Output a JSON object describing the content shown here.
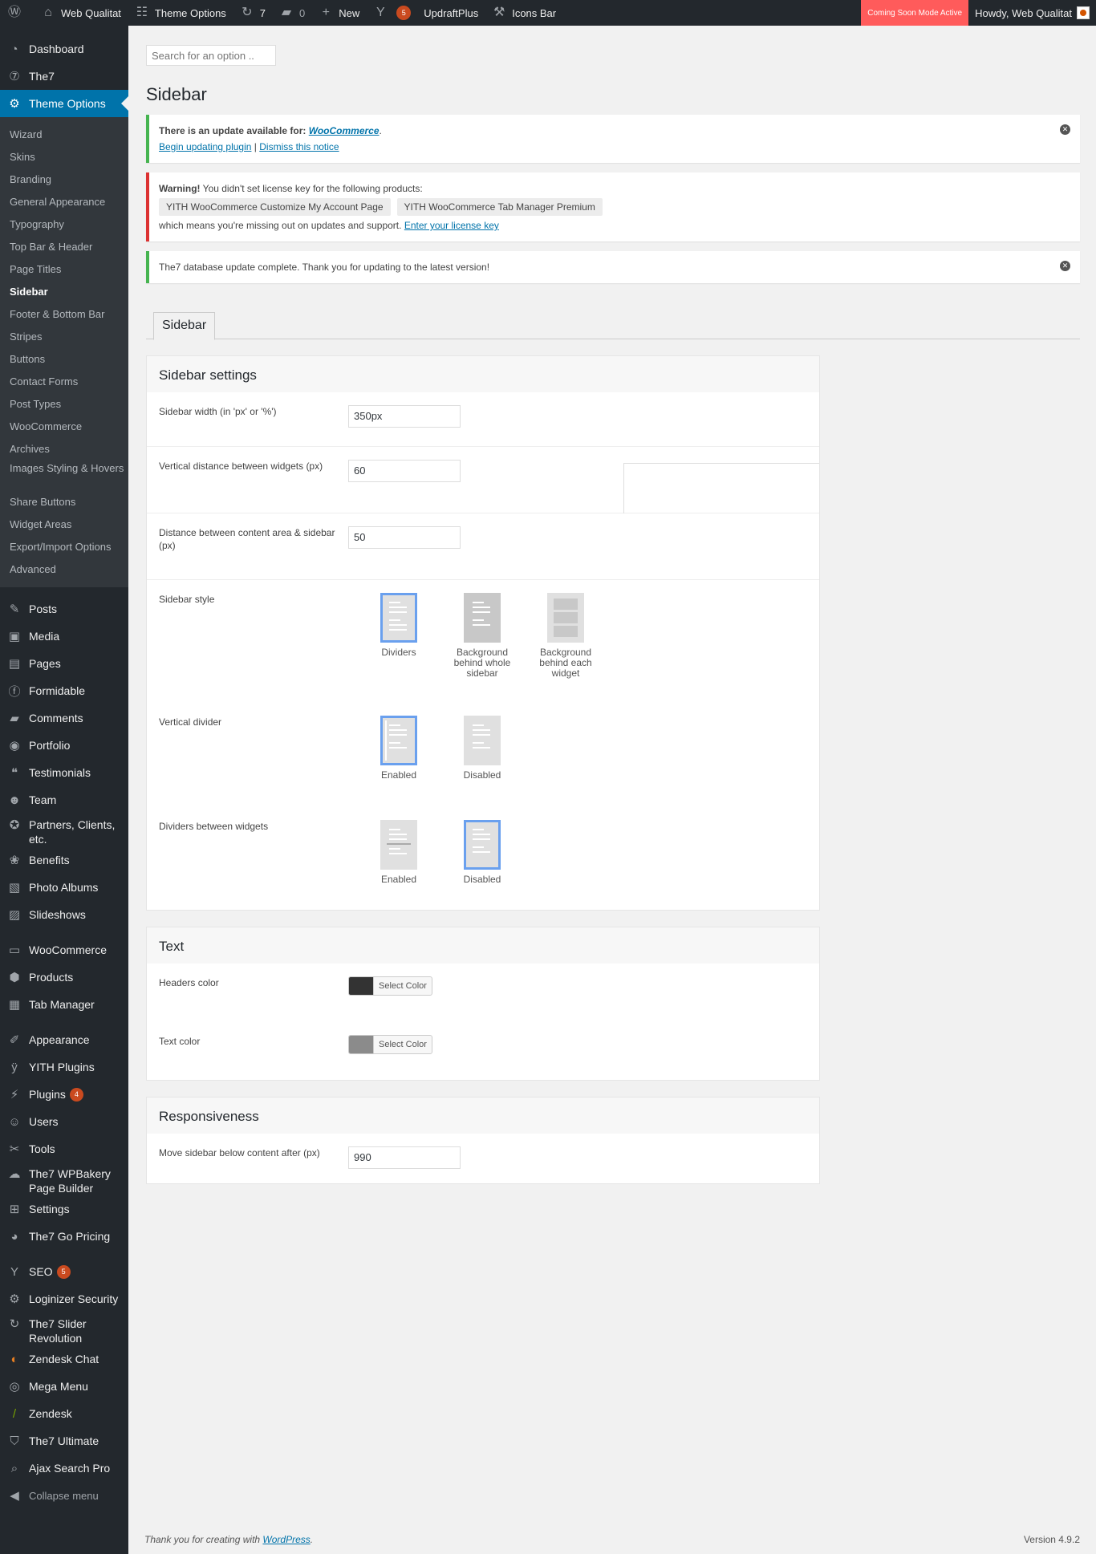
{
  "adminbar": {
    "site_name": "Web Qualitat",
    "theme_options": "Theme Options",
    "updates_count": "7",
    "comments_count": "0",
    "new_label": "New",
    "yoast_count": "5",
    "updraft": "UpdraftPlus",
    "icons_bar": "Icons Bar",
    "coming_soon": "Coming Soon Mode Active",
    "howdy": "Howdy, Web Qualitat"
  },
  "menu": {
    "top": [
      {
        "label": "Dashboard",
        "icon": "dashboard-icon"
      },
      {
        "label": "The7",
        "icon": "the7-icon"
      },
      {
        "label": "Theme Options",
        "icon": "gear-icon"
      }
    ],
    "submenu": [
      "Wizard",
      "Skins",
      "Branding",
      "General Appearance",
      "Typography",
      "Top Bar & Header",
      "Page Titles",
      "Sidebar",
      "Footer & Bottom Bar",
      "Stripes",
      "Buttons",
      "Contact Forms",
      "Post Types",
      "WooCommerce",
      "Archives",
      "Images Styling & Hovers",
      "Share Buttons",
      "Widget Areas",
      "Export/Import Options",
      "Advanced"
    ],
    "group1": [
      "Posts",
      "Media",
      "Pages",
      "Formidable",
      "Comments",
      "Portfolio",
      "Testimonials",
      "Team",
      "Partners, Clients, etc.",
      "Benefits",
      "Photo Albums",
      "Slideshows"
    ],
    "group2": [
      "WooCommerce",
      "Products",
      "Tab Manager"
    ],
    "group3": [
      "Appearance",
      "YITH Plugins",
      "Plugins",
      "Users",
      "Tools",
      "The7 WPBakery Page Builder",
      "Settings",
      "The7 Go Pricing"
    ],
    "plugins_count": "4",
    "group4": [
      "SEO",
      "Loginizer Security",
      "The7 Slider Revolution",
      "Zendesk Chat",
      "Mega Menu",
      "Zendesk",
      "The7 Ultimate",
      "Ajax Search Pro"
    ],
    "seo_count": "5",
    "collapse": "Collapse menu"
  },
  "search": {
    "placeholder": "Search for an option .."
  },
  "page_title": "Sidebar",
  "notices": {
    "update_text": "There is an update available for:",
    "update_link": "WooCommerce",
    "begin": "Begin updating plugin",
    "sep": "|",
    "dismiss": "Dismiss this notice",
    "warning_bold": "Warning!",
    "warning_text": "You didn't set license key for the following products:",
    "chip1": "YITH WooCommerce Customize My Account Page",
    "chip2": "YITH WooCommerce Tab Manager Premium",
    "missing": "which means you're missing out on updates and support.",
    "license_link": "Enter your license key",
    "db_update": "The7 database update complete. Thank you for updating to the latest version!"
  },
  "tab": "Sidebar",
  "sidebar_settings": {
    "title": "Sidebar settings",
    "width_label": "Sidebar width (in 'px' or '%')",
    "width_value": "350px",
    "vdist_label": "Vertical distance between widgets (px)",
    "vdist_value": "60",
    "cdist_label": "Distance between content area & sidebar (px)",
    "cdist_value": "50",
    "style_label": "Sidebar style",
    "style_opts": [
      "Dividers",
      "Background behind whole sidebar",
      "Background behind each widget"
    ],
    "vdivider_label": "Vertical divider",
    "vdivider_opts": [
      "Enabled",
      "Disabled"
    ],
    "dividers_label": "Dividers between widgets",
    "dividers_opts": [
      "Enabled",
      "Disabled"
    ]
  },
  "text_box": {
    "title": "Text",
    "headers_label": "Headers color",
    "headers_color": "#333333",
    "text_label": "Text color",
    "text_color": "#8b8b8b",
    "select_color": "Select Color"
  },
  "responsive": {
    "title": "Responsiveness",
    "move_label": "Move sidebar below content after (px)",
    "move_value": "990"
  },
  "footer": {
    "thanks": "Thank you for creating with",
    "wp_link": "WordPress",
    "version": "Version 4.9.2"
  }
}
